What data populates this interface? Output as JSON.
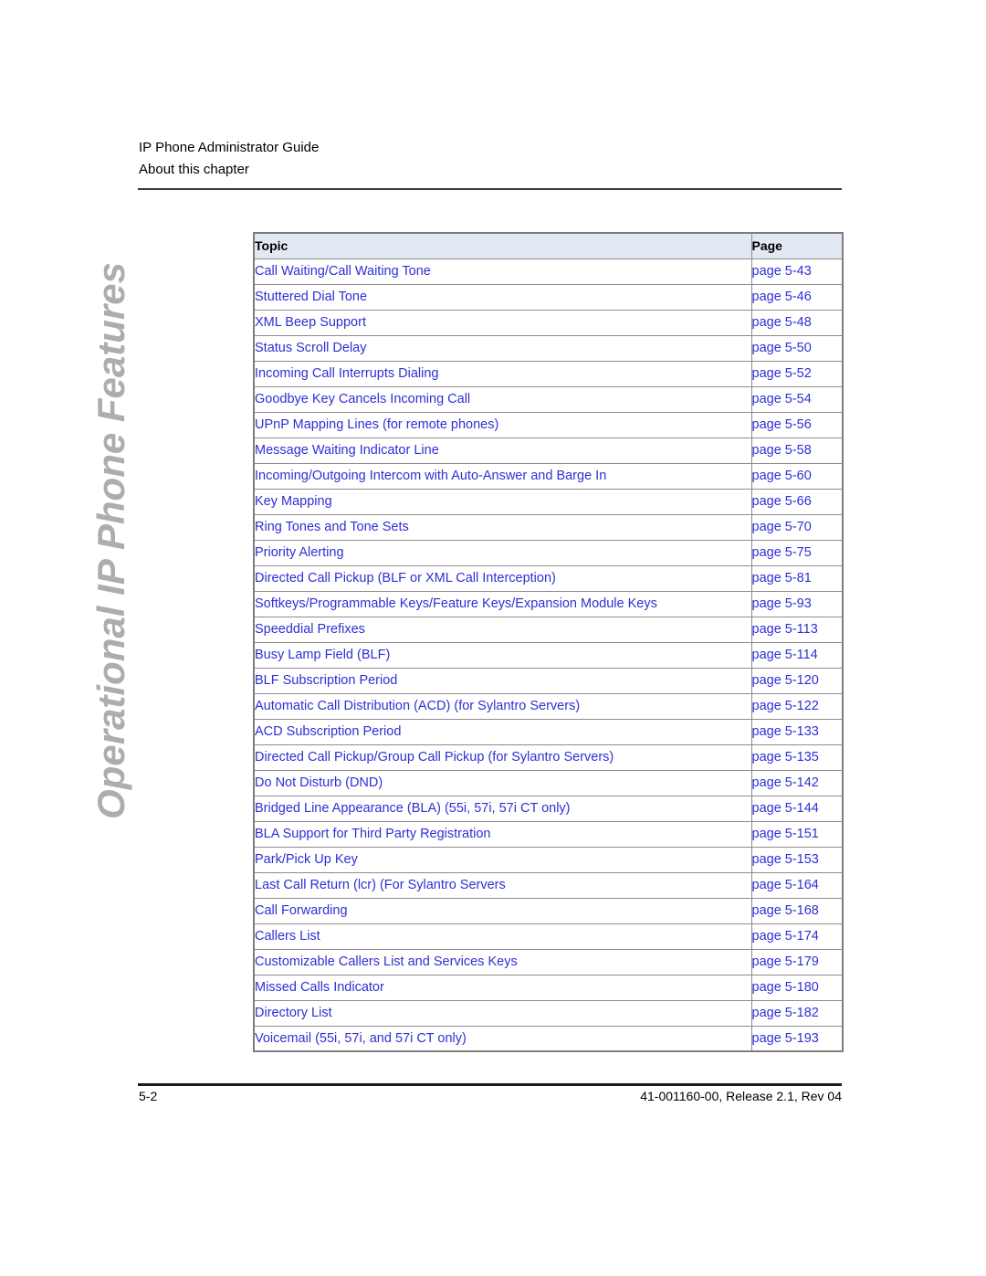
{
  "header": {
    "guide_title": "IP Phone Administrator Guide",
    "section_title": "About this chapter"
  },
  "chapter_tab": {
    "label": "Operational IP Phone Features",
    "color": "#adadad"
  },
  "table": {
    "columns": {
      "topic": "Topic",
      "page": "Page"
    },
    "link_color": "#2f2fd6",
    "header_background": "#e3e9f3",
    "rows": [
      {
        "topic": "Call Waiting/Call Waiting Tone",
        "page": "page 5-43"
      },
      {
        "topic": "Stuttered Dial Tone",
        "page": "page 5-46"
      },
      {
        "topic": "XML Beep Support",
        "page": "page 5-48"
      },
      {
        "topic": "Status Scroll Delay",
        "page": "page 5-50"
      },
      {
        "topic": "Incoming Call Interrupts Dialing",
        "page": "page 5-52"
      },
      {
        "topic": "Goodbye Key Cancels Incoming Call",
        "page": "page 5-54"
      },
      {
        "topic": "UPnP Mapping Lines (for remote phones)",
        "page": "page 5-56"
      },
      {
        "topic": "Message Waiting Indicator Line",
        "page": "page 5-58"
      },
      {
        "topic": "Incoming/Outgoing Intercom with Auto-Answer and Barge In",
        "page": "page 5-60"
      },
      {
        "topic": "Key Mapping",
        "page": "page 5-66"
      },
      {
        "topic": "Ring Tones and Tone Sets",
        "page": "page 5-70"
      },
      {
        "topic": "Priority Alerting",
        "page": "page 5-75"
      },
      {
        "topic": "Directed Call Pickup (BLF or XML Call Interception)",
        "page": "page 5-81"
      },
      {
        "topic": "Softkeys/Programmable Keys/Feature Keys/Expansion Module Keys",
        "page": "page 5-93"
      },
      {
        "topic": "Speeddial Prefixes",
        "page": "page 5-113"
      },
      {
        "topic": "Busy Lamp Field (BLF)",
        "page": "page 5-114"
      },
      {
        "topic": "BLF Subscription Period",
        "page": "page 5-120"
      },
      {
        "topic": "Automatic Call Distribution (ACD) (for Sylantro Servers)",
        "page": "page 5-122"
      },
      {
        "topic": "ACD Subscription Period",
        "page": "page 5-133"
      },
      {
        "topic": "Directed Call Pickup/Group Call Pickup (for Sylantro Servers)",
        "page": "page 5-135"
      },
      {
        "topic": "Do Not Disturb (DND)",
        "page": "page 5-142"
      },
      {
        "topic": "Bridged Line Appearance (BLA) (55i, 57i, 57i CT only)",
        "page": "page 5-144"
      },
      {
        "topic": "BLA Support for Third Party Registration",
        "page": "page 5-151"
      },
      {
        "topic": "Park/Pick Up Key",
        "page": "page 5-153"
      },
      {
        "topic": "Last Call Return (lcr) (For Sylantro Servers",
        "page": "page 5-164"
      },
      {
        "topic": "Call Forwarding",
        "page": "page 5-168"
      },
      {
        "topic": "Callers List",
        "page": "page 5-174"
      },
      {
        "topic": "Customizable Callers List and Services Keys",
        "page": "page 5-179"
      },
      {
        "topic": "Missed Calls Indicator",
        "page": "page 5-180"
      },
      {
        "topic": "Directory List",
        "page": "page 5-182"
      },
      {
        "topic": "Voicemail (55i, 57i, and 57i CT only)",
        "page": "page 5-193"
      }
    ]
  },
  "footer": {
    "page_number": "5-2",
    "document_id": "41-001160-00, Release 2.1, Rev 04"
  }
}
